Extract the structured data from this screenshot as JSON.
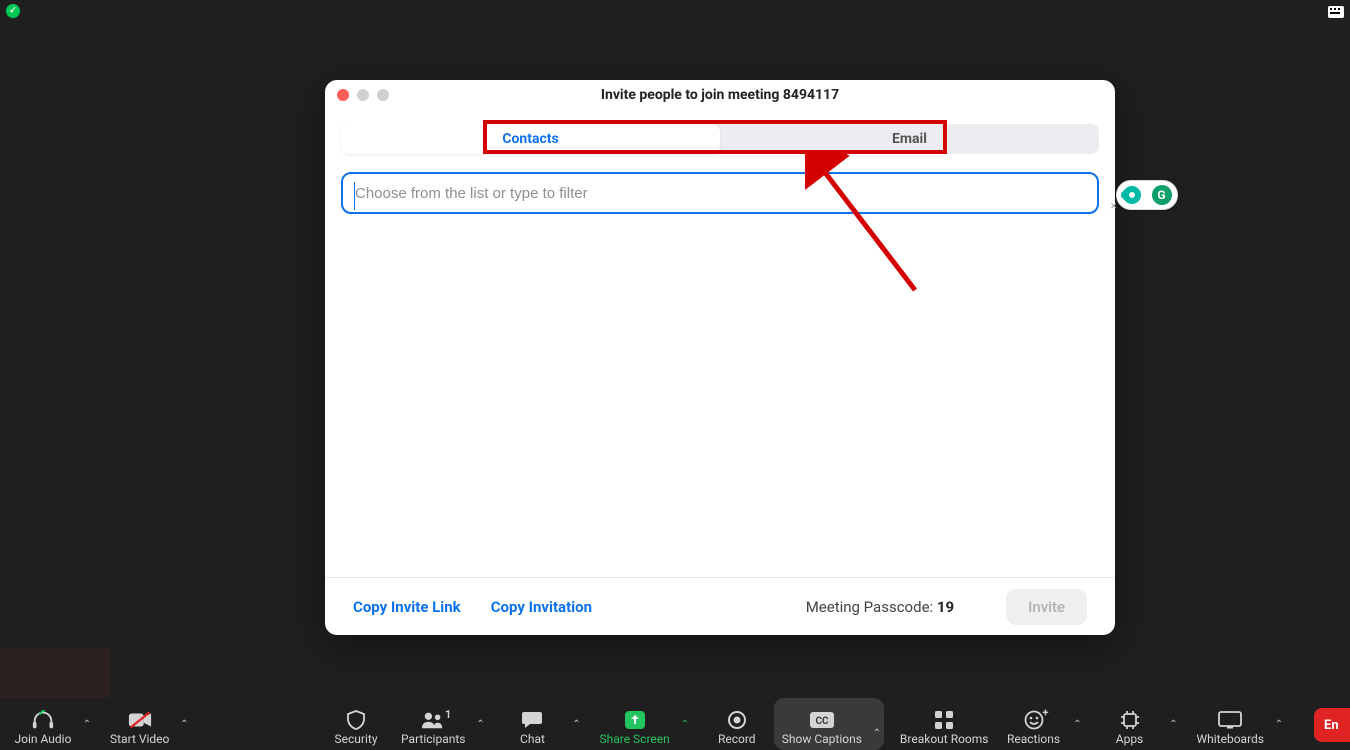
{
  "dialog": {
    "title": "Invite people to join meeting 8494117",
    "tabs": {
      "contacts": "Contacts",
      "email": "Email"
    },
    "search_placeholder": "Choose from the list or type to filter",
    "footer": {
      "copy_link": "Copy Invite Link",
      "copy_invitation": "Copy Invitation",
      "passcode_label": "Meeting Passcode: ",
      "passcode_value": "19",
      "invite": "Invite"
    }
  },
  "floating": {
    "letter": "G"
  },
  "toolbar": {
    "join_audio": "Join Audio",
    "start_video": "Start Video",
    "security": "Security",
    "participants": "Participants",
    "participants_count": "1",
    "chat": "Chat",
    "share_screen": "Share Screen",
    "record": "Record",
    "show_captions": "Show Captions",
    "breakout_rooms": "Breakout Rooms",
    "reactions": "Reactions",
    "apps": "Apps",
    "whiteboards": "Whiteboards",
    "end": "En"
  }
}
